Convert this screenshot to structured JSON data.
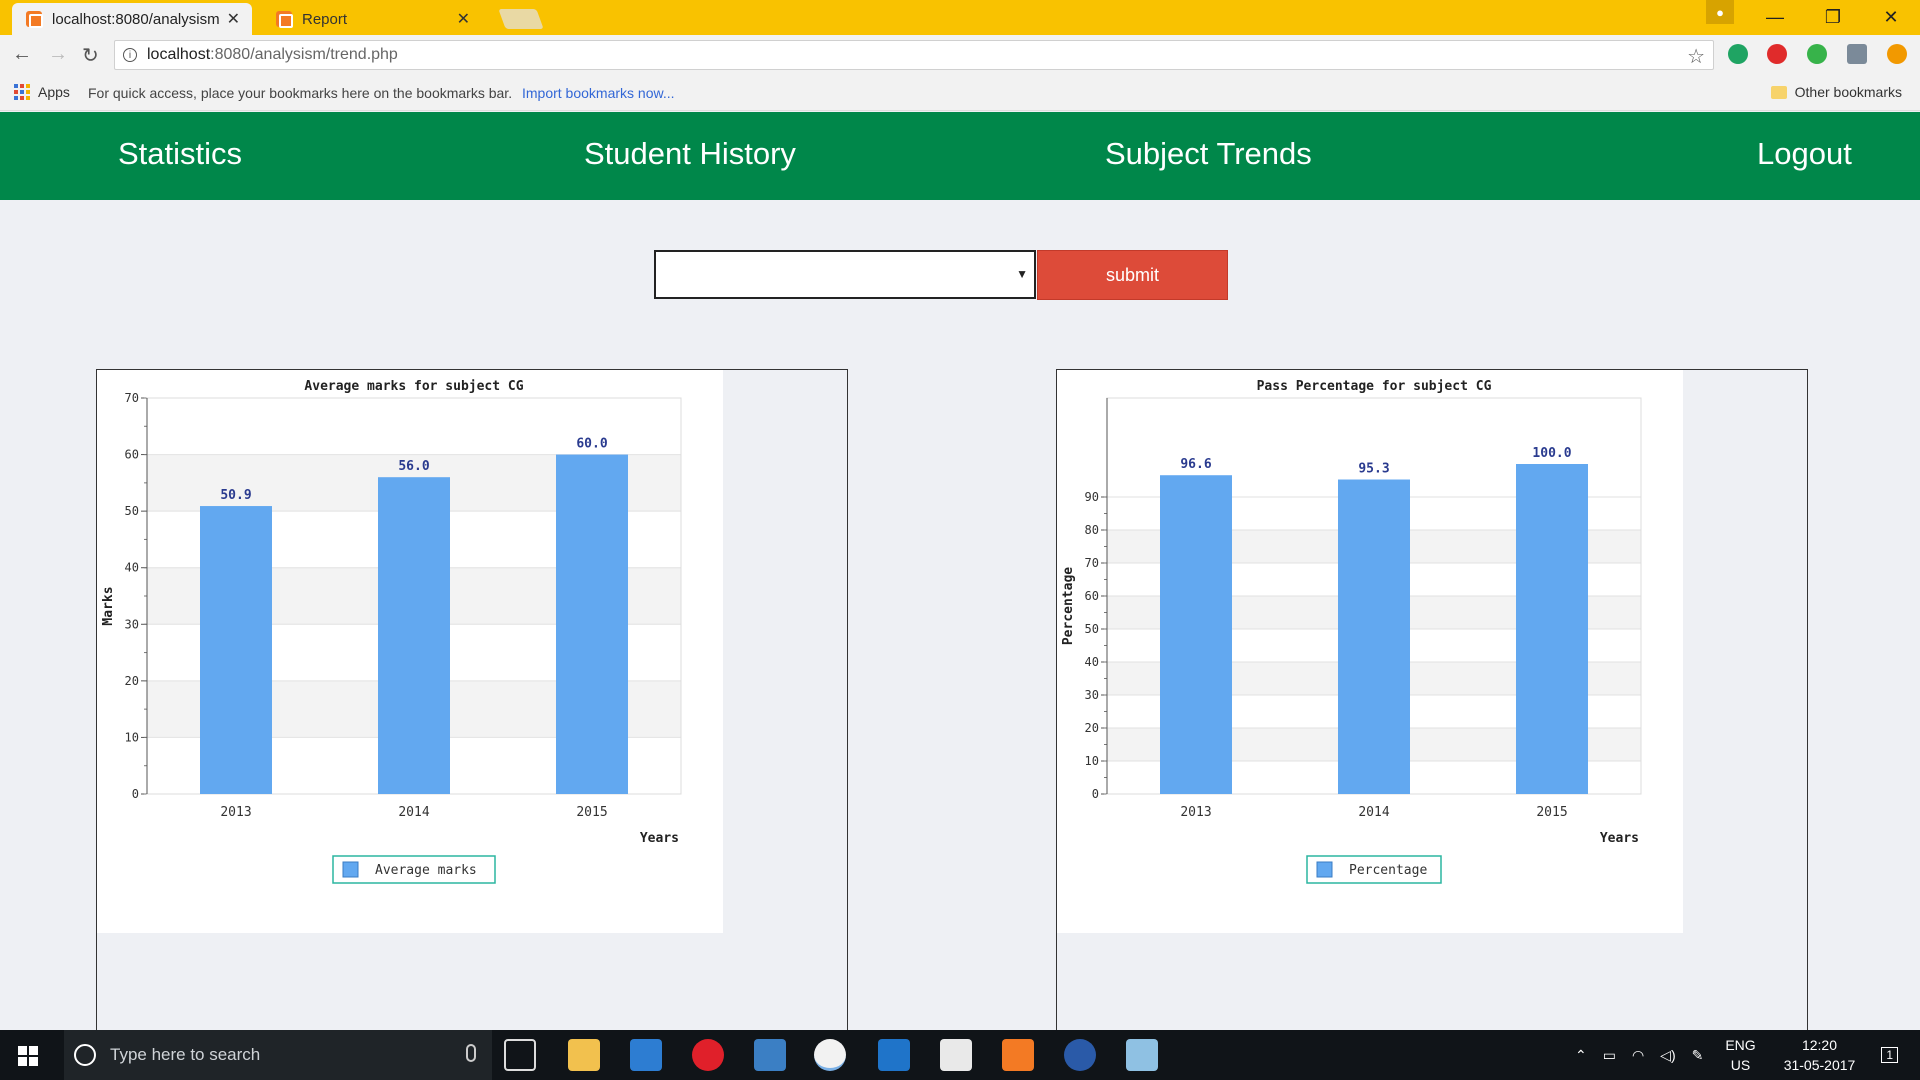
{
  "browser": {
    "tabs": [
      {
        "label": "localhost:8080/analysism",
        "active": true
      },
      {
        "label": "Report",
        "active": false
      }
    ],
    "address": {
      "host": "localhost",
      "rest": ":8080/analysism/trend.php"
    },
    "bookmarks": {
      "apps_label": "Apps",
      "hint": "For quick access, place your bookmarks here on the bookmarks bar.",
      "import_link": "Import bookmarks now...",
      "other_label": "Other bookmarks"
    }
  },
  "nav": {
    "items": [
      "Statistics",
      "Student History",
      "Subject Trends",
      "Logout"
    ]
  },
  "form": {
    "select_value": "",
    "submit_label": "submit"
  },
  "chart_data": [
    {
      "type": "bar",
      "title": "Average marks for subject CG",
      "categories": [
        "2013",
        "2014",
        "2015"
      ],
      "series": [
        {
          "name": "Average marks",
          "values": [
            50.9,
            56.0,
            60.0
          ]
        }
      ],
      "data_labels": [
        "50.9",
        "56.0",
        "60.0"
      ],
      "xlabel": "Years",
      "ylabel": "Marks",
      "ylim": [
        0,
        70
      ],
      "yticks": [
        0,
        10,
        20,
        30,
        40,
        50,
        60,
        70
      ],
      "grid": true,
      "legend": "bottom-center",
      "color": "#62a8f0"
    },
    {
      "type": "bar",
      "title": "Pass Percentage for subject CG",
      "categories": [
        "2013",
        "2014",
        "2015"
      ],
      "series": [
        {
          "name": "Percentage",
          "values": [
            96.6,
            95.3,
            100.0
          ]
        }
      ],
      "data_labels": [
        "96.6",
        "95.3",
        "100.0"
      ],
      "xlabel": "Years",
      "ylabel": "Percentage",
      "ylim": [
        0,
        120
      ],
      "yticks": [
        0,
        10,
        20,
        30,
        40,
        50,
        60,
        70,
        80,
        90
      ],
      "grid": true,
      "legend": "bottom-center",
      "color": "#62a8f0"
    }
  ],
  "taskbar": {
    "search_placeholder": "Type here to search",
    "lang_top": "ENG",
    "lang_bottom": "US",
    "time": "12:20",
    "date": "31-05-2017",
    "notification_count": "1"
  },
  "colors": {
    "nav_bg": "#00874a",
    "submit_bg": "#dd4b39",
    "tabbar_bg": "#f9c200",
    "bar": "#62a8f0"
  }
}
